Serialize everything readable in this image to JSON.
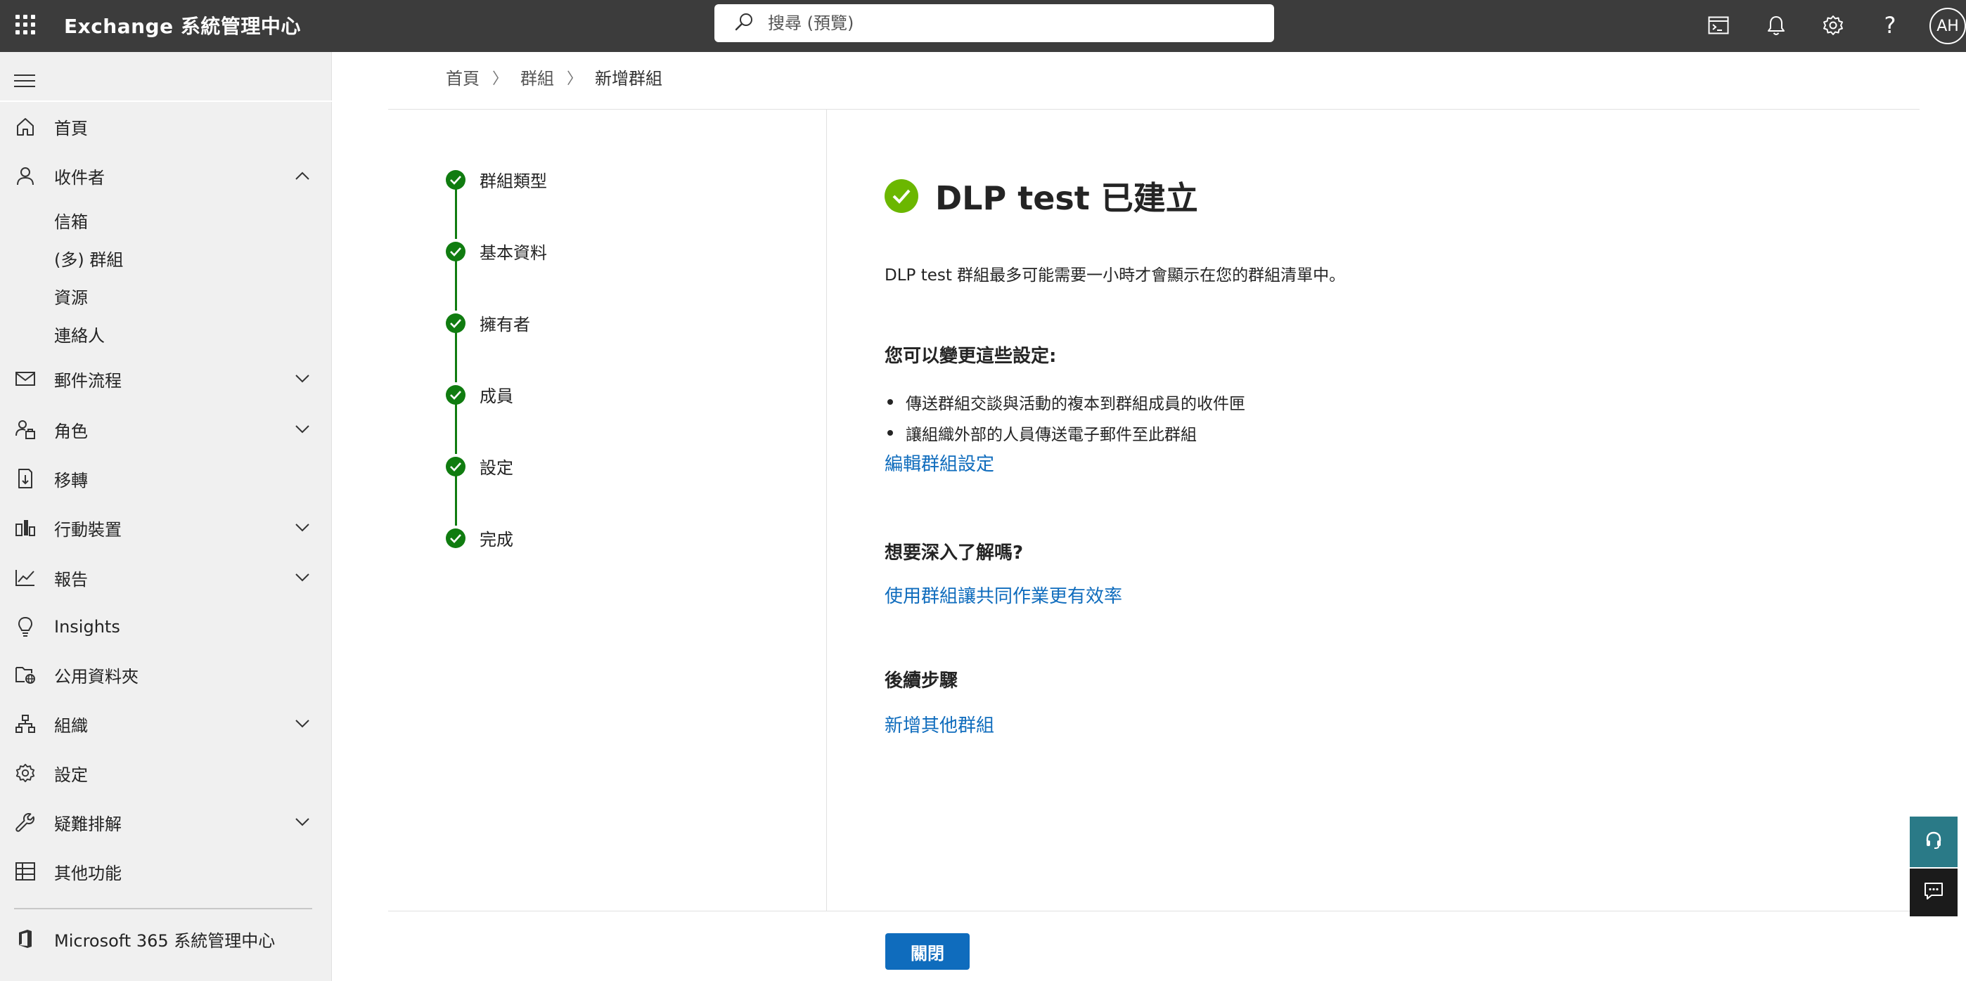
{
  "header": {
    "app_title": "Exchange 系統管理中心",
    "search_placeholder": "搜尋 (預覽)",
    "avatar_initials": "AH",
    "icons": [
      "waffle-icon",
      "cloud-shell-icon",
      "notifications-icon",
      "settings-icon",
      "help-icon"
    ]
  },
  "sidebar": {
    "items": [
      {
        "label": "首頁",
        "icon": "home-icon"
      },
      {
        "label": "收件者",
        "icon": "person-icon",
        "expanded": true
      },
      {
        "label": "郵件流程",
        "icon": "mail-icon"
      },
      {
        "label": "角色",
        "icon": "roles-icon"
      },
      {
        "label": "移轉",
        "icon": "migration-icon"
      },
      {
        "label": "行動裝置",
        "icon": "mobile-icon"
      },
      {
        "label": "報告",
        "icon": "reports-icon"
      },
      {
        "label": "Insights",
        "icon": "lightbulb-icon"
      },
      {
        "label": "公用資料夾",
        "icon": "public-folder-icon"
      },
      {
        "label": "組織",
        "icon": "organization-icon"
      },
      {
        "label": "設定",
        "icon": "settings-icon"
      },
      {
        "label": "疑難排解",
        "icon": "wrench-icon"
      },
      {
        "label": "其他功能",
        "icon": "table-icon"
      }
    ],
    "recipient_subitems": [
      "信箱",
      "(多) 群組",
      "資源",
      "連絡人"
    ],
    "footer_link": "Microsoft 365 系統管理中心"
  },
  "breadcrumb": [
    "首頁",
    "群組",
    "新增群組"
  ],
  "wizard": {
    "steps": [
      "群組類型",
      "基本資料",
      "擁有者",
      "成員",
      "設定",
      "完成"
    ]
  },
  "main": {
    "title": "DLP test 已建立",
    "description": "DLP test 群組最多可能需要一小時才會顯示在您的群組清單中。",
    "settings_heading": "您可以變更這些設定:",
    "settings_bullets": [
      "傳送群組交談與活動的複本到群組成員的收件匣",
      "讓組織外部的人員傳送電子郵件至此群組"
    ],
    "edit_link": "編輯群組設定",
    "learn_heading": "想要深入了解嗎?",
    "learn_link": "使用群組讓共同作業更有效率",
    "next_heading": "後續步驟",
    "next_link": "新增其他群組"
  },
  "footer": {
    "close_label": "關閉"
  },
  "colors": {
    "topbar": "#3c3c3c",
    "accent": "#0f6cbd",
    "step_green": "#107c10",
    "success_green": "#6bb700"
  }
}
